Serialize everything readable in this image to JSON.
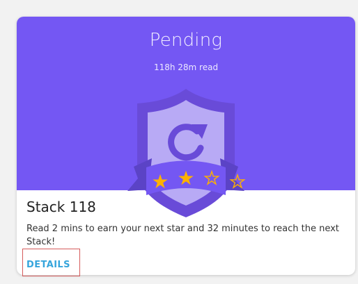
{
  "card": {
    "status": "Pending",
    "read_time": "118h 28m read",
    "title": "Stack 118",
    "description": "Read 2 mins to earn your next star and 32 minutes to reach the next Stack!",
    "details_label": "DETAILS",
    "stars": {
      "earned": 2,
      "total": 4
    },
    "badge_icon": "refresh-icon"
  },
  "colors": {
    "header_background": "#7457f3",
    "shield_outer": "#694bd8",
    "shield_inner": "#b8aaf5",
    "ribbon": "#5b43c6",
    "star": "#ffb100",
    "details_link": "#36a5dc"
  }
}
